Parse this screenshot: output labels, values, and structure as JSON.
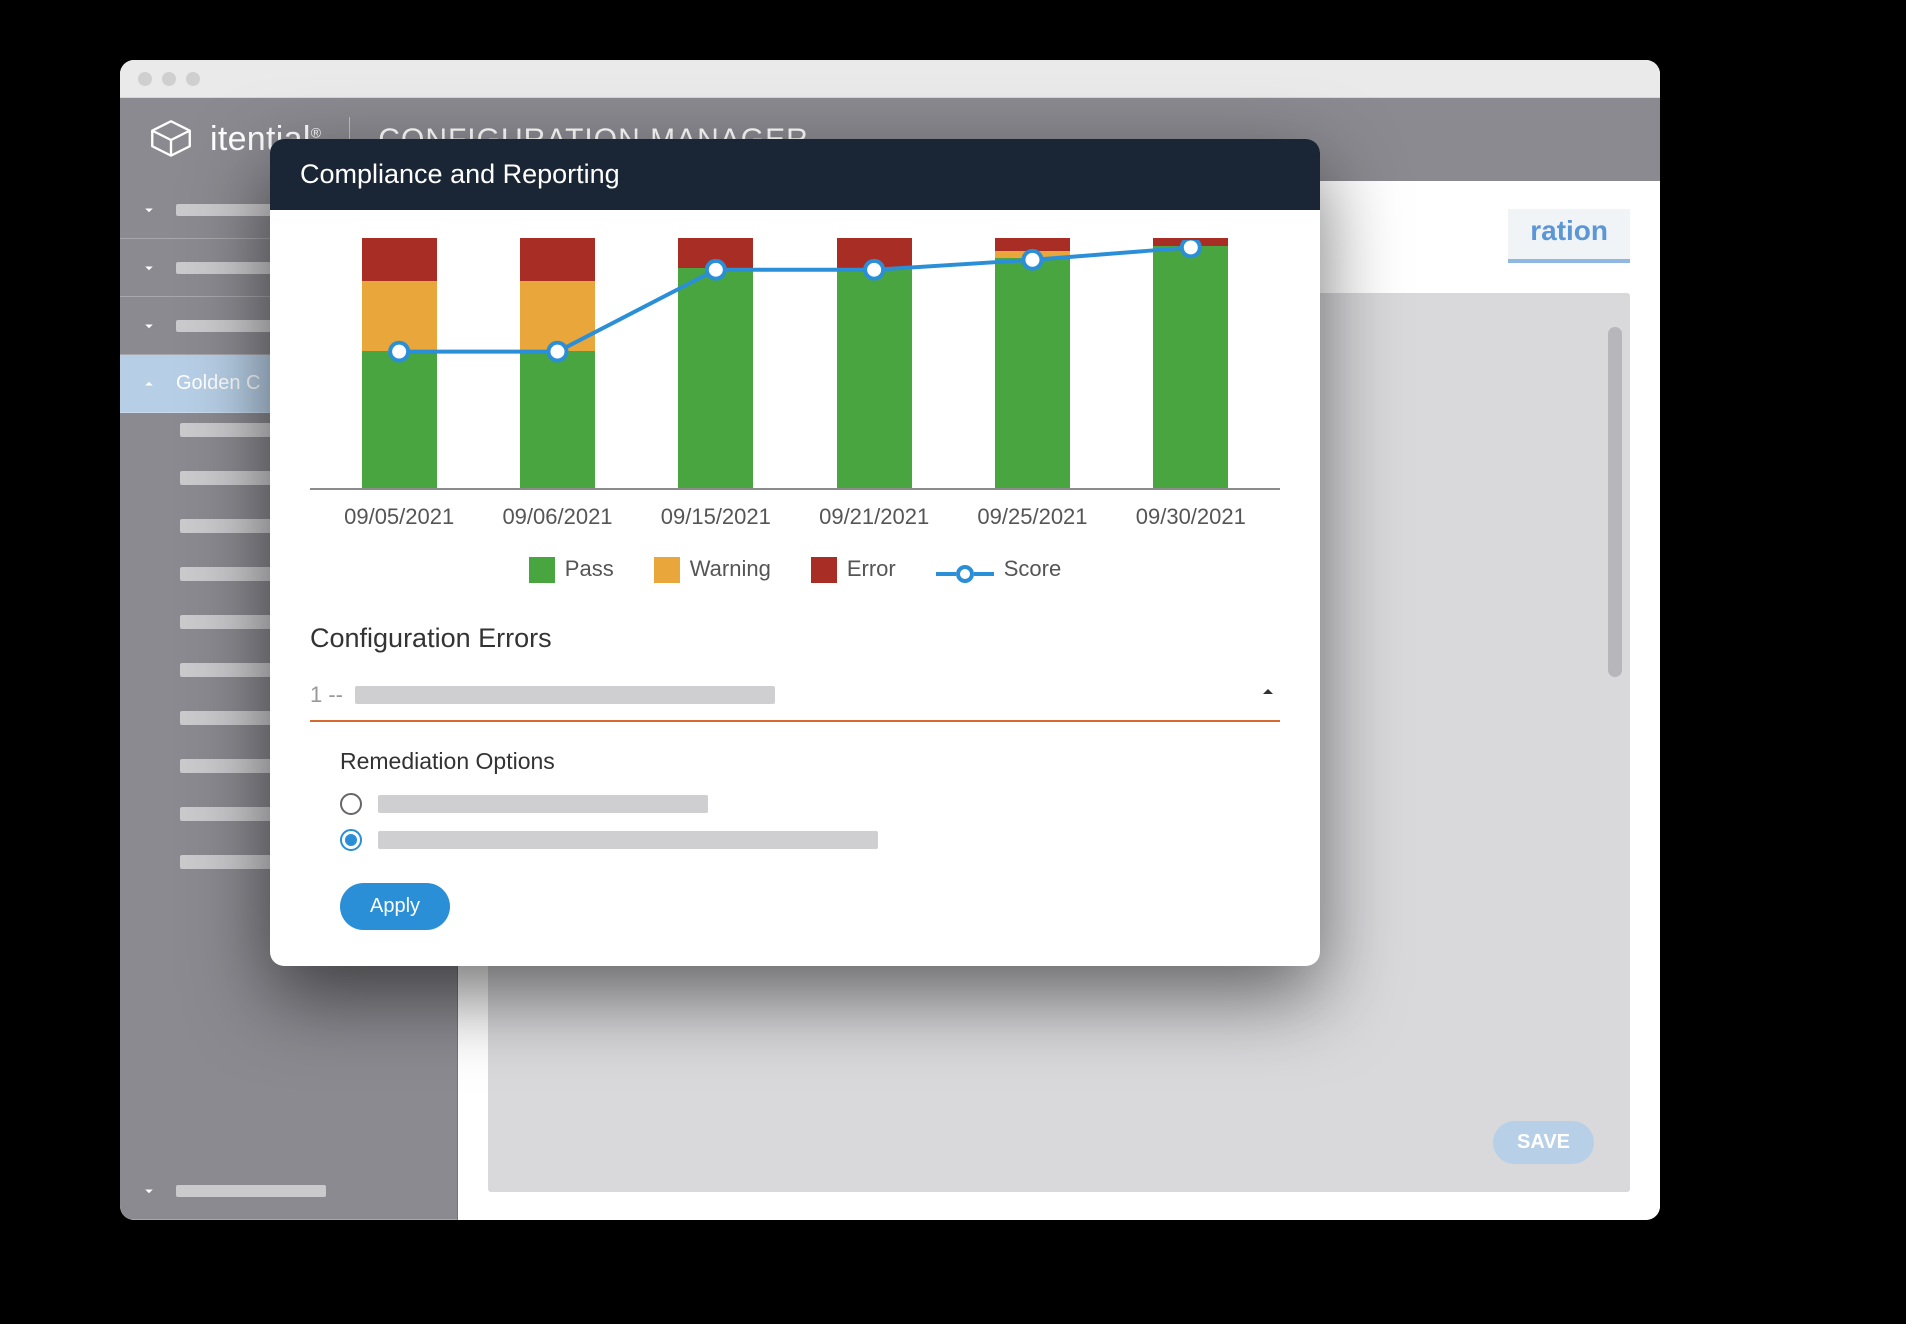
{
  "header": {
    "brand": "itential",
    "app_title": "CONFIGURATION MANAGER"
  },
  "sidebar": {
    "active_item_label": "Golden C"
  },
  "main": {
    "tab_label_fragment": "ration",
    "save_label": "SAVE"
  },
  "modal": {
    "title": "Compliance and Reporting",
    "config_errors_title": "Configuration Errors",
    "error_row_prefix": "1 --",
    "remediation_title": "Remediation Options",
    "apply_label": "Apply"
  },
  "legend": {
    "pass": "Pass",
    "warning": "Warning",
    "error": "Error",
    "score": "Score"
  },
  "colors": {
    "pass": "#49a53f",
    "warning": "#e9a63b",
    "error": "#a82e25",
    "score_line": "#2a8fd6"
  },
  "chart_data": {
    "type": "bar",
    "stacked": true,
    "overlay": "line",
    "categories": [
      "09/05/2021",
      "09/06/2021",
      "09/15/2021",
      "09/21/2021",
      "09/25/2021",
      "09/30/2021"
    ],
    "series": [
      {
        "name": "Pass",
        "values": [
          55,
          55,
          88,
          88,
          92,
          97
        ]
      },
      {
        "name": "Warning",
        "values": [
          28,
          28,
          0,
          0,
          3,
          0
        ]
      },
      {
        "name": "Error",
        "values": [
          17,
          17,
          12,
          12,
          5,
          3
        ]
      }
    ],
    "line_series": {
      "name": "Score",
      "values": [
        55,
        55,
        88,
        88,
        92,
        97
      ]
    },
    "ylim": [
      0,
      100
    ],
    "ylabel": "",
    "xlabel": "",
    "title": ""
  }
}
